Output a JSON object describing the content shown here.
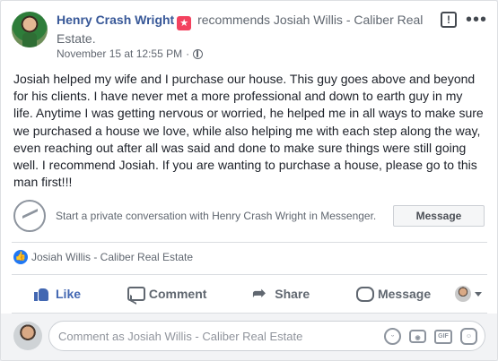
{
  "post": {
    "author": "Henry Crash Wright",
    "action_text": "recommends",
    "target": "Josiah Willis - Caliber Real Estate.",
    "timestamp": "November 15 at 12:55 PM",
    "separator": "·",
    "privacy_icon": "globe-icon",
    "body": "Josiah helped my wife and I purchase our house. This guy goes above and beyond for his clients. I have never met a more professional and down to earth guy in my life. Anytime I was getting nervous or worried, he helped me in all ways to make sure we purchased a house we love, while also helping me with each step along the way, even reaching out after all was said and done to make sure things were still going well. I recommend Josiah. If you are wanting to purchase a house, please go to this man first!!!"
  },
  "messenger": {
    "prompt": "Start a private conversation with Henry Crash Wright in Messenger.",
    "button_label": "Message"
  },
  "reactions": {
    "liked_by": "Josiah Willis - Caliber Real Estate"
  },
  "actions": {
    "like": "Like",
    "comment": "Comment",
    "share": "Share",
    "message": "Message"
  },
  "comment_box": {
    "placeholder": "Comment as Josiah Willis - Caliber Real Estate",
    "gif_label": "GIF"
  },
  "colors": {
    "link": "#385898",
    "accent": "#4267b2",
    "badge": "#f3425f"
  }
}
